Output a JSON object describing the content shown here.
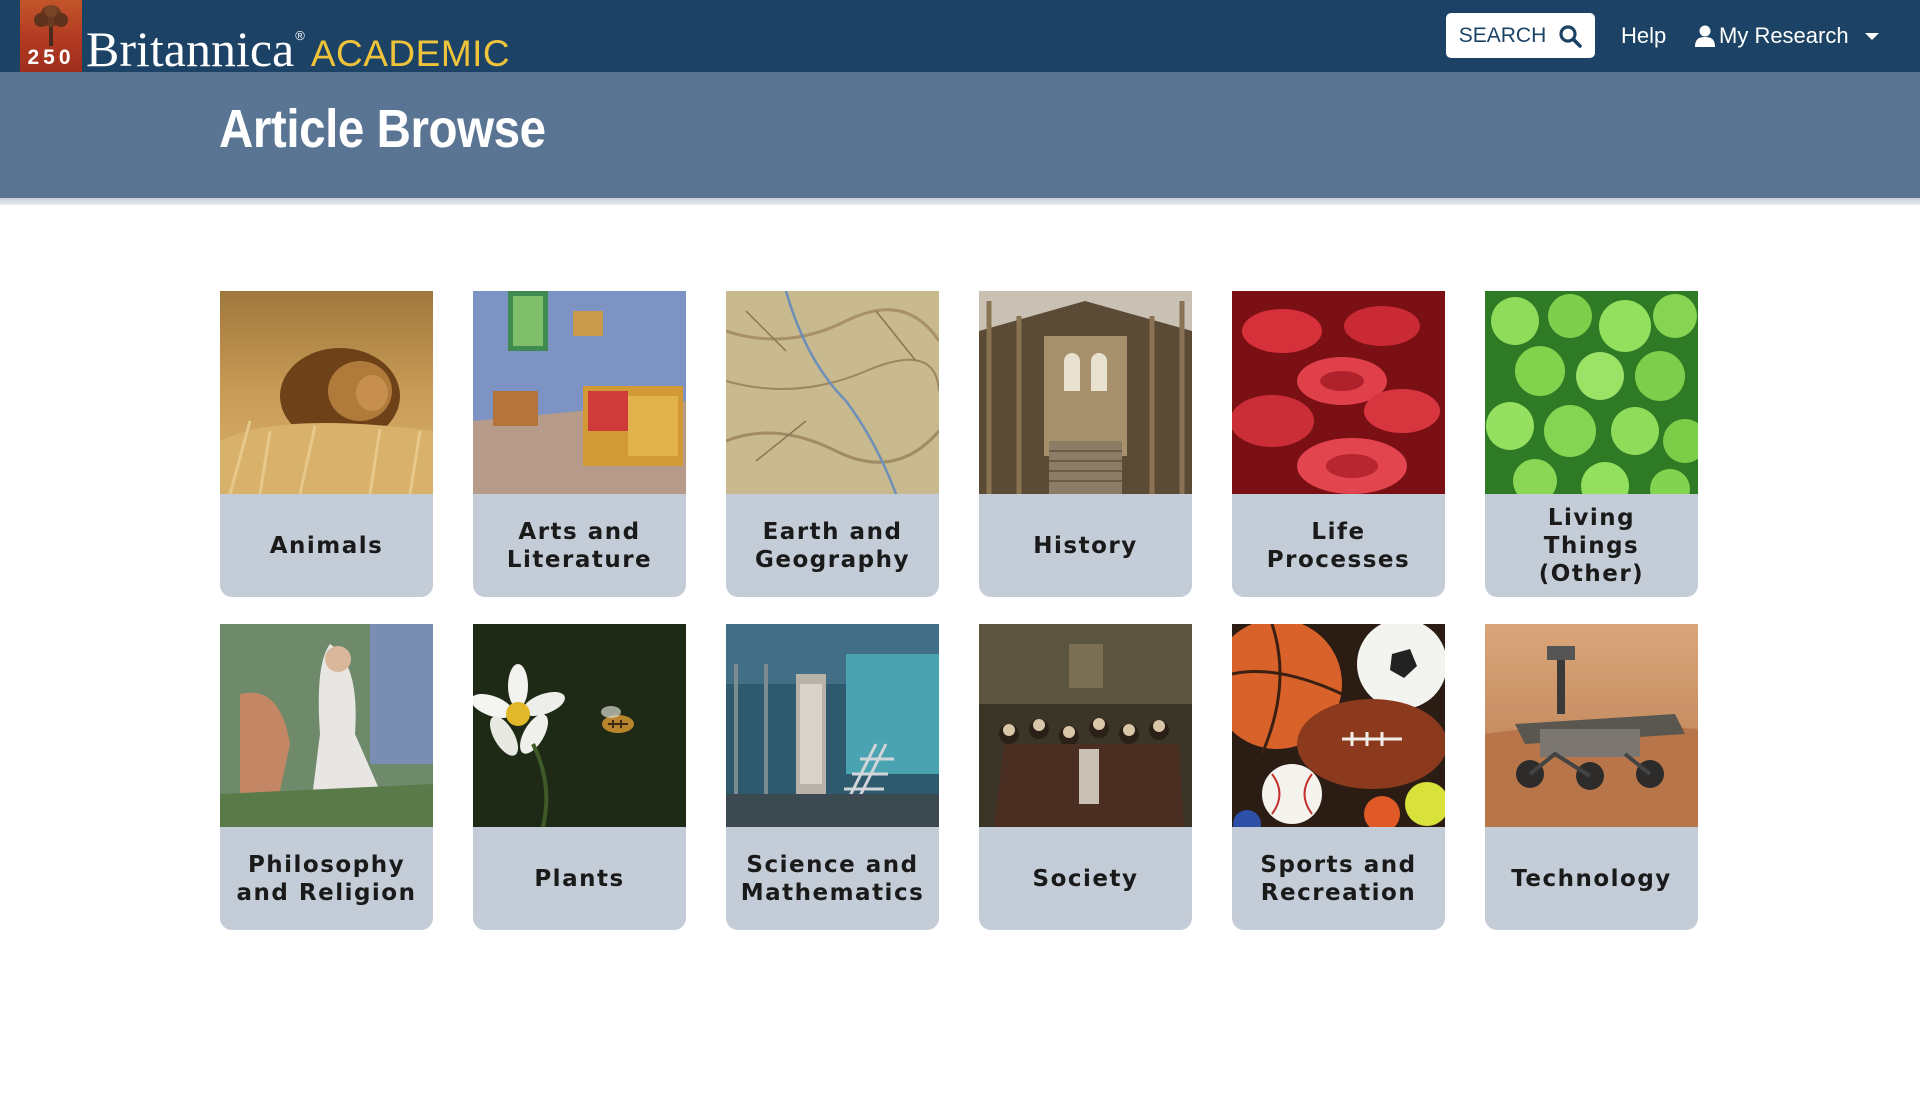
{
  "topbar": {
    "brand_name": "Britannica",
    "brand_suffix": "ACADEMIC",
    "anniversary": "250",
    "search_label": "SEARCH",
    "help_label": "Help",
    "research_label": "My Research"
  },
  "header": {
    "title": "Article Browse"
  },
  "categories": [
    {
      "label": "Animals",
      "image": "lion-in-grass"
    },
    {
      "label": "Arts and Literature",
      "image": "van-gogh-bedroom-painting"
    },
    {
      "label": "Earth and Geography",
      "image": "relief-map"
    },
    {
      "label": "History",
      "image": "museum-hall"
    },
    {
      "label": "Life Processes",
      "image": "red-blood-cells"
    },
    {
      "label": "Living Things (Other)",
      "image": "green-cells"
    },
    {
      "label": "Philosophy and Religion",
      "image": "symbolist-painting"
    },
    {
      "label": "Plants",
      "image": "daisy-and-bee"
    },
    {
      "label": "Science and Mathematics",
      "image": "laboratory"
    },
    {
      "label": "Society",
      "image": "salon-painting"
    },
    {
      "label": "Sports and Recreation",
      "image": "sports-balls"
    },
    {
      "label": "Technology",
      "image": "mars-rover"
    }
  ]
}
